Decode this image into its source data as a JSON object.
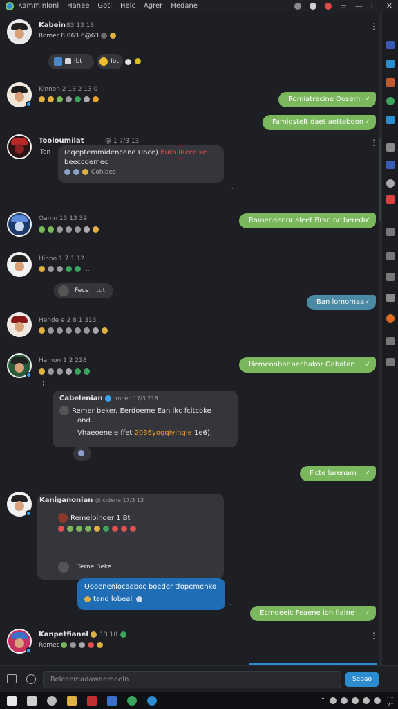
{
  "titlebar": {
    "menu": [
      "Kamminlonl",
      "Hanee",
      "Gotl",
      "Helc",
      "Agrer",
      "Hedane"
    ],
    "active_menu_index": 1
  },
  "messages": {
    "m1": {
      "name": "Kabein",
      "meta": "83 13 13",
      "status": "Romer 8 063 6@63",
      "pill1": "Ibt",
      "pill2": "Ibt"
    },
    "m2": {
      "sub": "Kinnon 2 13 2 13 0",
      "out": "Romiatrecine Oosem"
    },
    "m3": {
      "out": "Famidstelt daet aettebdon"
    },
    "m4": {
      "name": "Tooloumilat",
      "meta": "@ 1 7/3 13",
      "sub": "Ten",
      "text1": "(cqeptemmidencene Ubce)",
      "text1_hl": "bura iRcceike",
      "text2": "beeccdemec",
      "react": "Cohlaes"
    },
    "m5": {
      "sub": "Oamn 13 13 39",
      "out": "Ramenaenor aleet Bran oc beredn"
    },
    "m6": {
      "sub": "Hinbo 1 7 1 12",
      "reply": "Fece",
      "reply_meta": "tot"
    },
    "m7": {
      "out": "Ban lomomaa"
    },
    "m8": {
      "sub": "Hende e 2 8 1 313",
      "out": "Hemeonbar aechakor Oabaton"
    },
    "m9": {
      "sub": "Hamon 1 2 218",
      "quote_name": "Cabelenian",
      "quote_meta": "Imben 17/3 218",
      "quote_l1": "Remer beker. Eerdoeme Ean ikc fcitcoke",
      "quote_l2": "ond.",
      "quote_l3": "Vhaeoeneie ffet",
      "quote_hl": "2036yogqiyingie",
      "quote_tail": "1e6)."
    },
    "m10": {
      "out": "Ficte larenam"
    },
    "m11": {
      "name": "Kaniganonian",
      "meta": "@ cidena 17/3 13",
      "line": "Remeloinoer 1 Bt",
      "reply": "Terne Beke",
      "blue1": "Oooenenlocaaboc boeder tfopemenko",
      "blue2": "tand lobeal"
    },
    "m12": {
      "out": "Ecmdeeic Feaene ion fialne"
    },
    "m13": {
      "name": "Kanpetfianel",
      "meta": "13 10",
      "sub": "Romet"
    }
  },
  "composer": {
    "placeholder": "Relecemadawnemeeln",
    "send_label": "Sebao"
  },
  "colors": {
    "out_bubble": "#7bb75c",
    "teal_bubble": "#4b8aa5",
    "blue_bubble": "#1f6eb5",
    "accent": "#2d8bd0"
  }
}
